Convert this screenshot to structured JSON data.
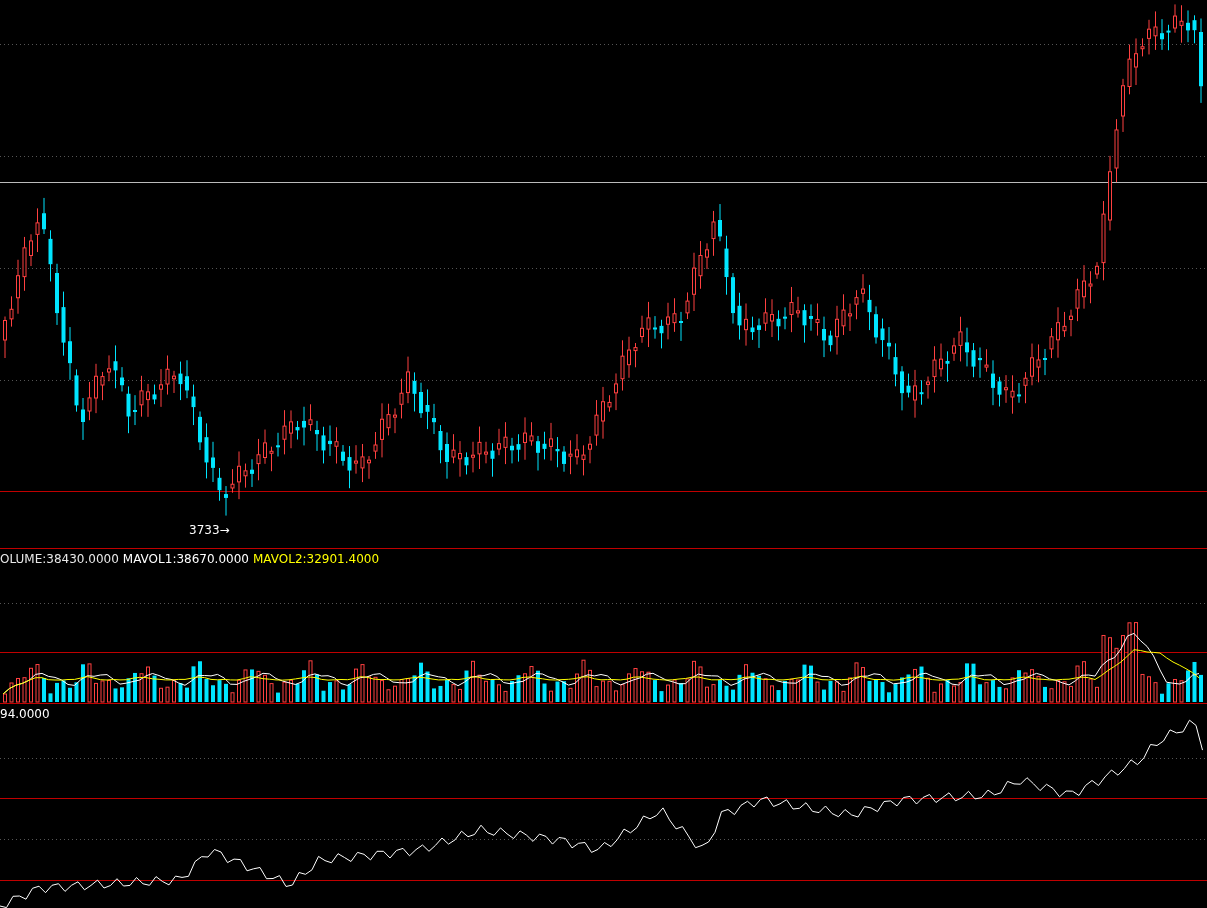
{
  "price_panel": {
    "low_marker": "3733→"
  },
  "volume_panel": {
    "readouts": [
      {
        "text": "OLUME:38430.0000",
        "color": "#e8e8e8"
      },
      {
        "text": "MAVOL1:38670.0000",
        "color": "#ffffff"
      },
      {
        "text": "MAVOL2:32901.4000",
        "color": "#ffff00"
      }
    ]
  },
  "indicator_panel": {
    "readout": "94.0000"
  }
}
